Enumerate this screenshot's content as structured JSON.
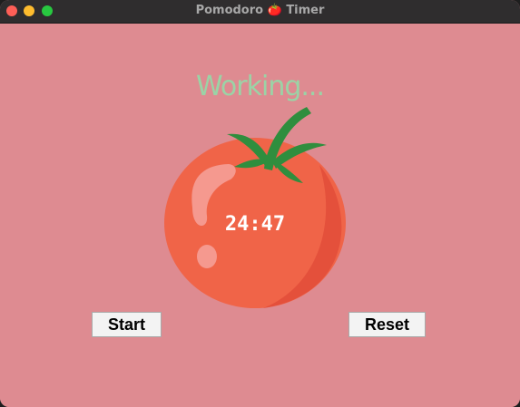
{
  "window": {
    "title": "Pomodoro 🍅 Timer"
  },
  "timer": {
    "status": "Working...",
    "time": "24:47"
  },
  "buttons": {
    "start_label": "Start",
    "reset_label": "Reset"
  },
  "colors": {
    "background": "#de8b91",
    "status_text": "#9bd3a6",
    "tomato": "#f06448",
    "leaf": "#2f8e3e",
    "timer_text": "#ffffff"
  }
}
